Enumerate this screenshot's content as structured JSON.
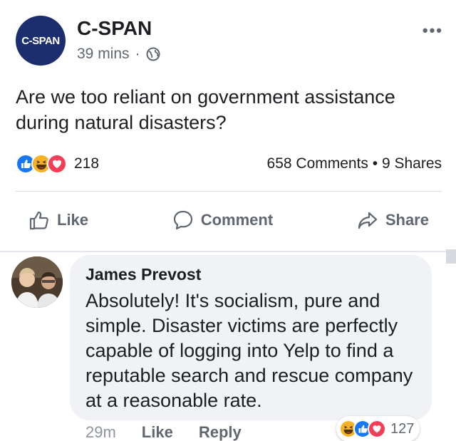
{
  "post": {
    "page_name": "C-SPAN",
    "avatar_text": "C-SPAN",
    "time": "39 mins",
    "dot": "·",
    "more": "•••",
    "text": "Are we too reliant on government assistance during natural disasters?",
    "reactions": [
      "like",
      "haha",
      "love"
    ],
    "reaction_count": "218",
    "comments_shares": "658 Comments • 9 Shares"
  },
  "actions": {
    "like": "Like",
    "comment": "Comment",
    "share": "Share"
  },
  "comment": {
    "author": "James Prevost",
    "text": "Absolutely! It's socialism, pure and simple. Disaster victims are perfectly capable of logging into Yelp to find a reputable search and rescue company at a reasonable rate.",
    "time": "29m",
    "like": "Like",
    "reply": "Reply",
    "reactions": [
      "haha",
      "like",
      "love"
    ],
    "reaction_count": "127"
  },
  "colors": {
    "like_blue": "#1877f2",
    "love_red": "#f33e58",
    "haha_yellow": "#f7b125",
    "cspan_navy": "#1c2e6e"
  }
}
